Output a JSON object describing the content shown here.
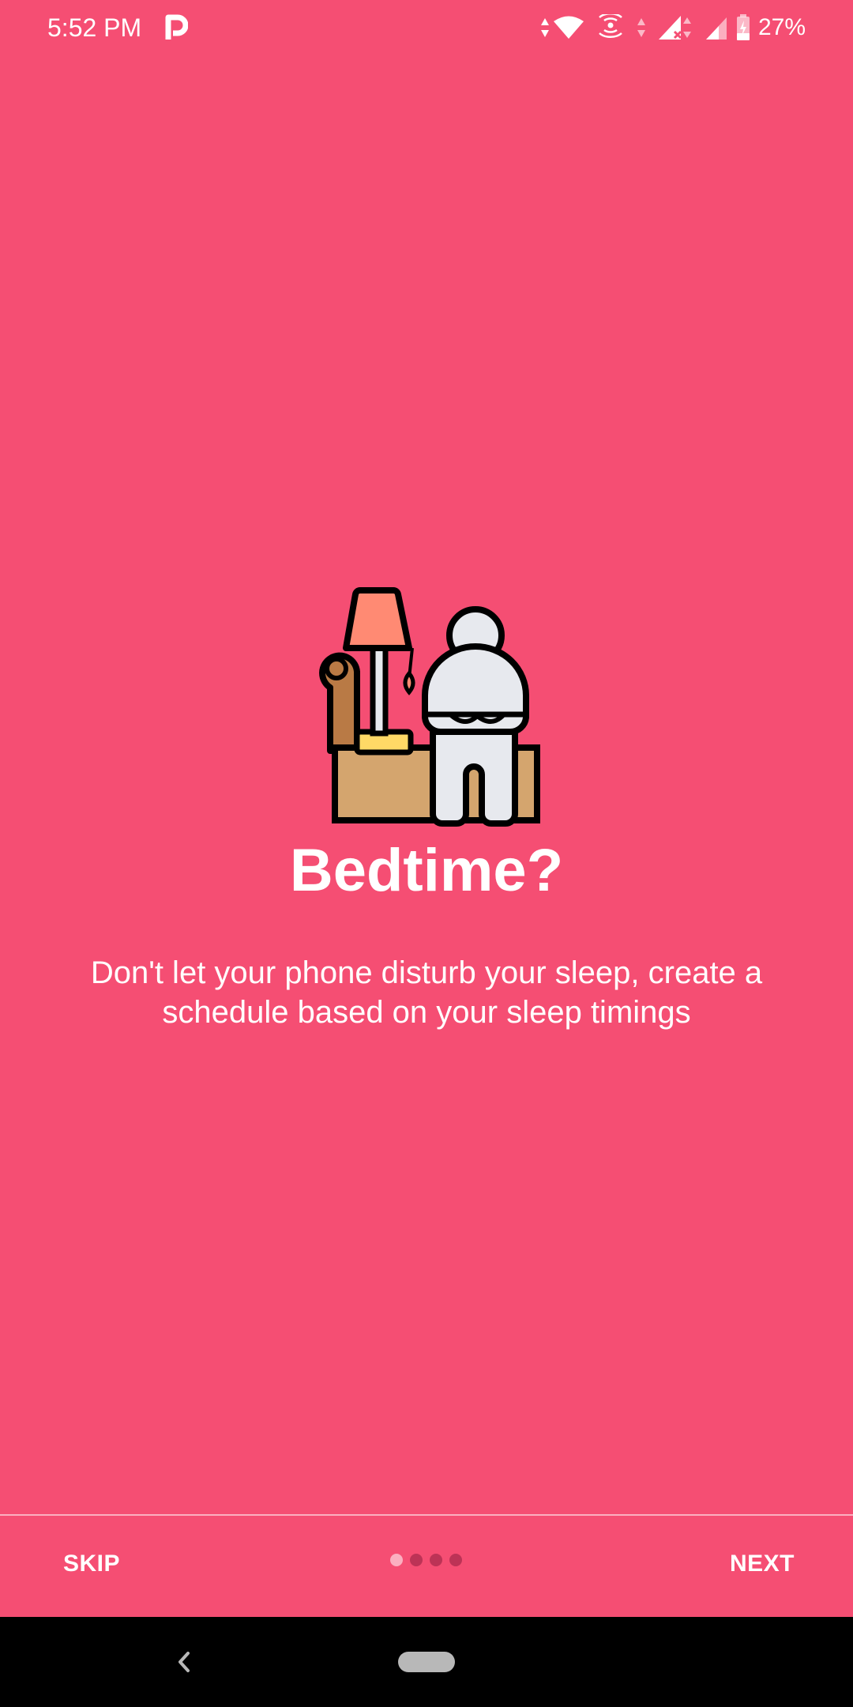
{
  "status_bar": {
    "time": "5:52 PM",
    "app_icon": "p-icon",
    "icons": [
      "data-arrows-icon",
      "wifi-icon",
      "hotspot-icon",
      "data-arrows-icon",
      "signal-no-service-icon",
      "signal-icon",
      "battery-charging-icon"
    ],
    "battery": "27%"
  },
  "onboarding": {
    "illustration": "person-on-couch-with-lamp-icon",
    "title": "Bedtime?",
    "description": "Don't let your phone disturb your sleep, create a schedule based on your sleep timings",
    "skip_label": "SKIP",
    "next_label": "NEXT",
    "page_count": 4,
    "current_page": 1
  },
  "nav_bar": {
    "back": "back-icon",
    "home": "home-pill"
  },
  "colors": {
    "background": "#f54e73",
    "text": "#ffffff",
    "nav_bar": "#000000"
  }
}
